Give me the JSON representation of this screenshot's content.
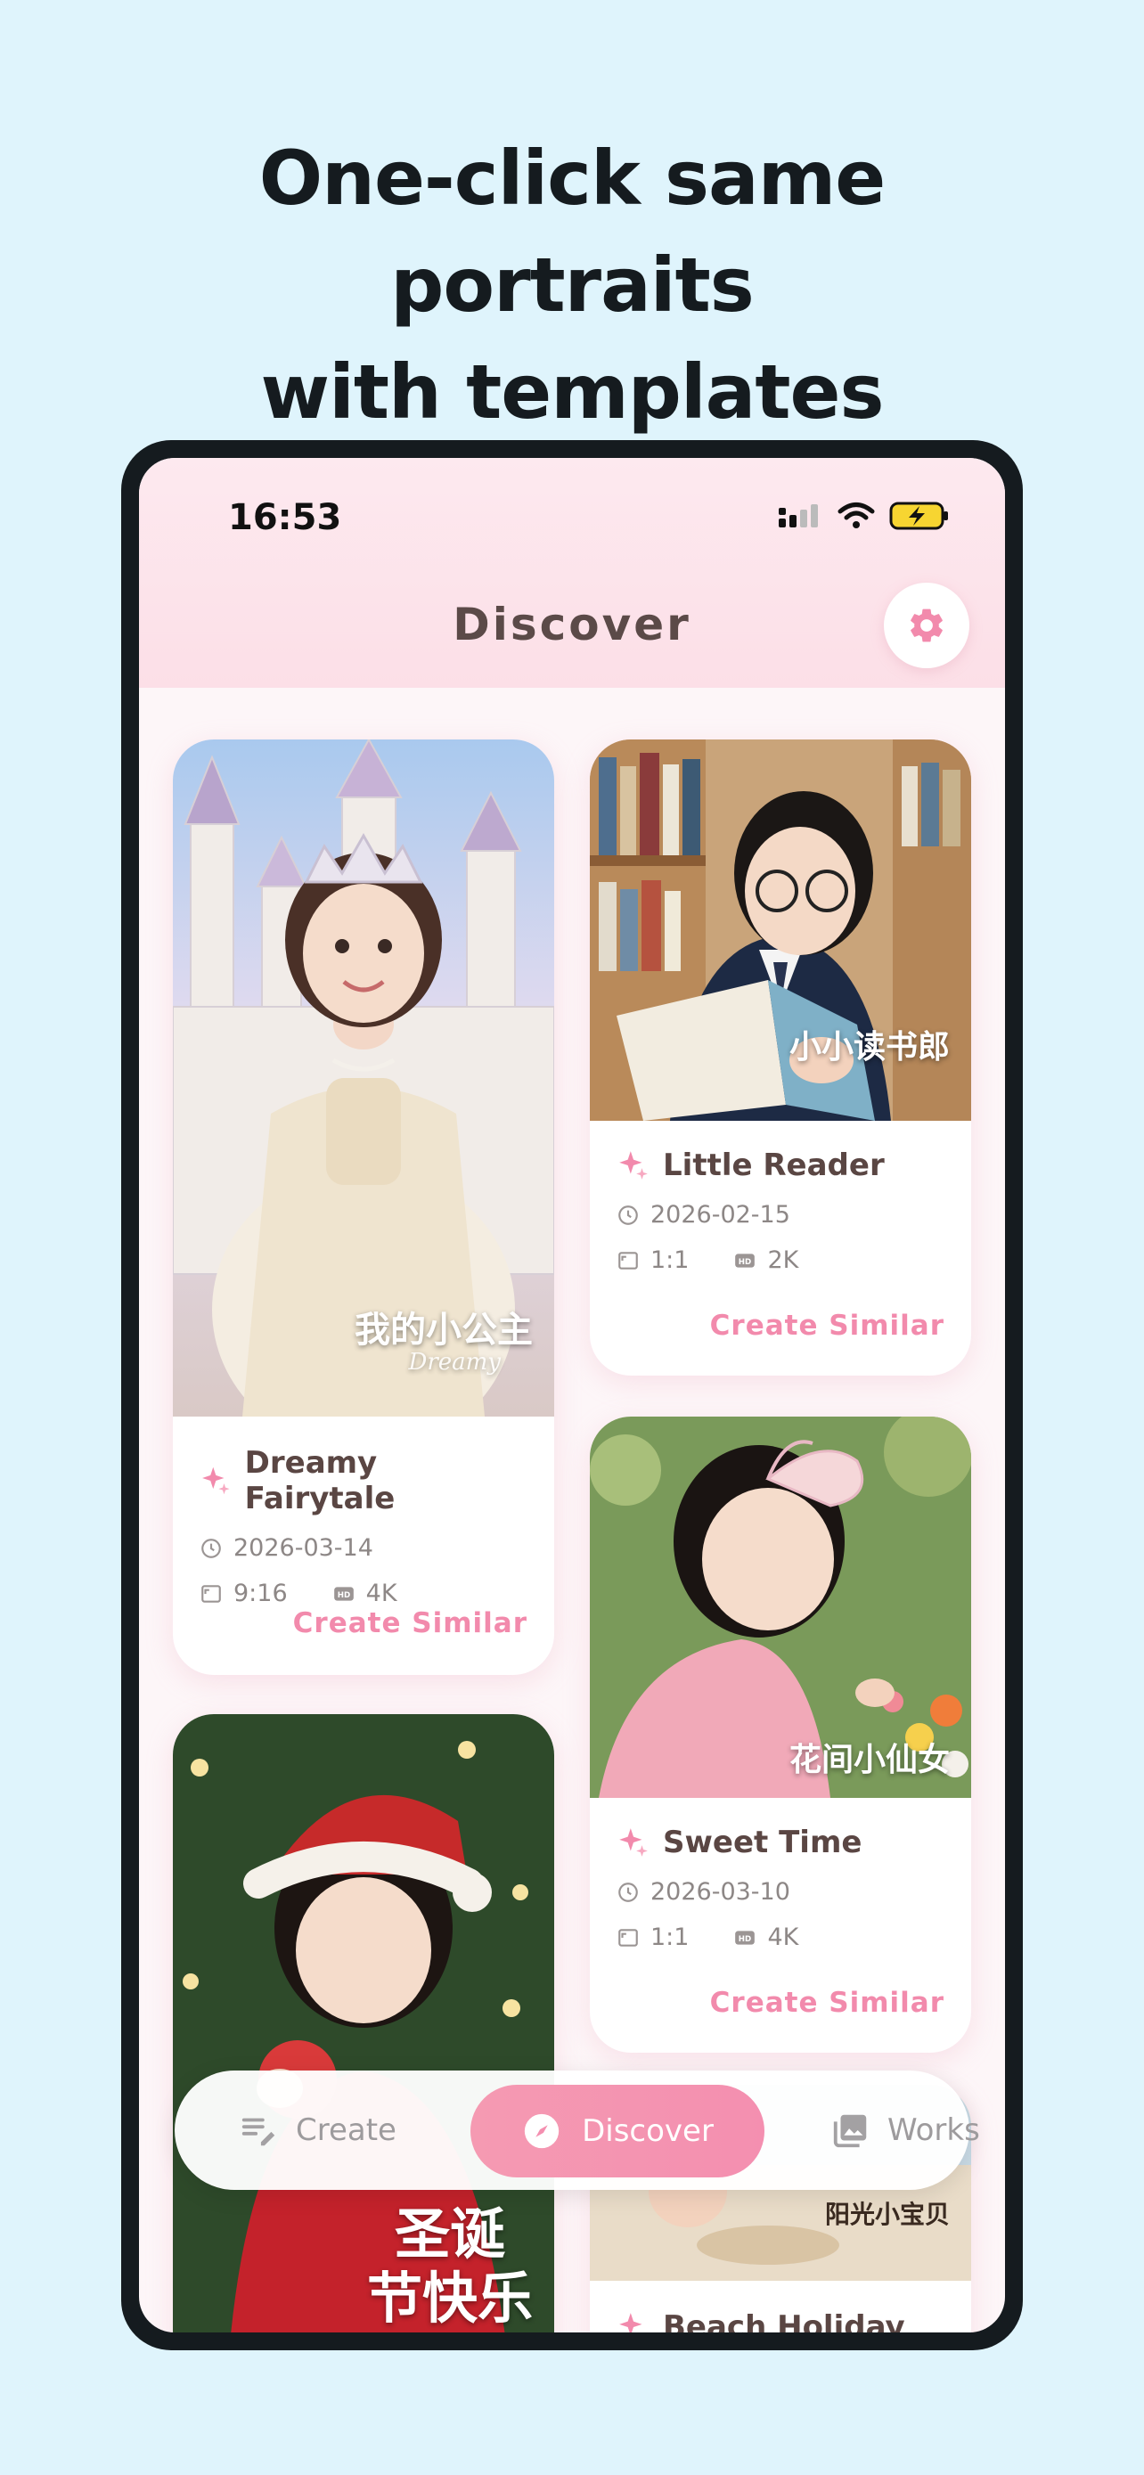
{
  "headline": {
    "line1": "One-click same",
    "line2": "portraits",
    "line3": "with templates"
  },
  "status_bar": {
    "time": "16:53"
  },
  "header": {
    "title": "Discover",
    "settings_icon": "gear-icon"
  },
  "accent_color": "#f28aac",
  "cards": [
    {
      "title": "Dreamy Fairytale",
      "date": "2026-03-14",
      "ratio": "9:16",
      "quality": "4K",
      "action": "Create Similar",
      "overlay": "我的小公主",
      "overlay_script": "Dreamy"
    },
    {
      "title": "Little Reader",
      "date": "2026-02-15",
      "ratio": "1:1",
      "quality": "2K",
      "action": "Create Similar",
      "overlay": "小小读书郎"
    },
    {
      "title": "Sweet Time",
      "date": "2026-03-10",
      "ratio": "1:1",
      "quality": "4K",
      "action": "Create Similar",
      "overlay": "花间小仙女"
    },
    {
      "overlay": "圣诞\n节快乐"
    },
    {
      "title": "Beach Holiday",
      "overlay": "阳光小宝贝"
    }
  ],
  "nav": {
    "create": "Create",
    "discover": "Discover",
    "works": "Works"
  }
}
